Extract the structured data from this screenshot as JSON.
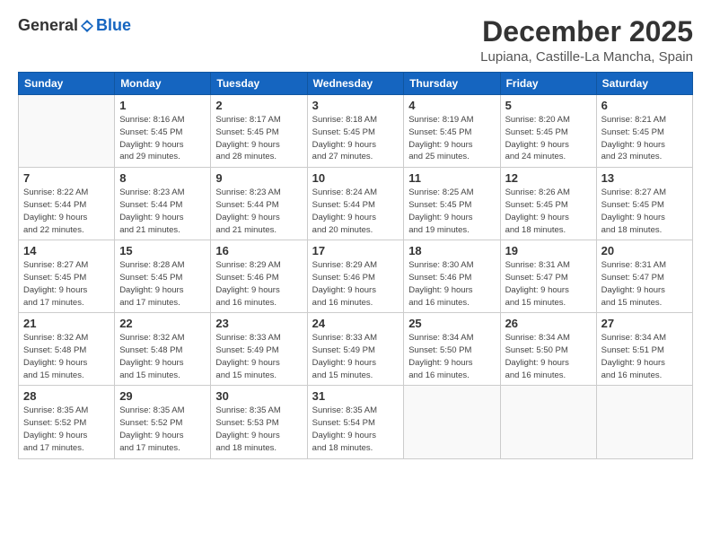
{
  "header": {
    "logo_general": "General",
    "logo_blue": "Blue",
    "month": "December 2025",
    "location": "Lupiana, Castille-La Mancha, Spain"
  },
  "days_of_week": [
    "Sunday",
    "Monday",
    "Tuesday",
    "Wednesday",
    "Thursday",
    "Friday",
    "Saturday"
  ],
  "weeks": [
    [
      {
        "day": "",
        "info": ""
      },
      {
        "day": "1",
        "info": "Sunrise: 8:16 AM\nSunset: 5:45 PM\nDaylight: 9 hours\nand 29 minutes."
      },
      {
        "day": "2",
        "info": "Sunrise: 8:17 AM\nSunset: 5:45 PM\nDaylight: 9 hours\nand 28 minutes."
      },
      {
        "day": "3",
        "info": "Sunrise: 8:18 AM\nSunset: 5:45 PM\nDaylight: 9 hours\nand 27 minutes."
      },
      {
        "day": "4",
        "info": "Sunrise: 8:19 AM\nSunset: 5:45 PM\nDaylight: 9 hours\nand 25 minutes."
      },
      {
        "day": "5",
        "info": "Sunrise: 8:20 AM\nSunset: 5:45 PM\nDaylight: 9 hours\nand 24 minutes."
      },
      {
        "day": "6",
        "info": "Sunrise: 8:21 AM\nSunset: 5:45 PM\nDaylight: 9 hours\nand 23 minutes."
      }
    ],
    [
      {
        "day": "7",
        "info": "Sunrise: 8:22 AM\nSunset: 5:44 PM\nDaylight: 9 hours\nand 22 minutes."
      },
      {
        "day": "8",
        "info": "Sunrise: 8:23 AM\nSunset: 5:44 PM\nDaylight: 9 hours\nand 21 minutes."
      },
      {
        "day": "9",
        "info": "Sunrise: 8:23 AM\nSunset: 5:44 PM\nDaylight: 9 hours\nand 21 minutes."
      },
      {
        "day": "10",
        "info": "Sunrise: 8:24 AM\nSunset: 5:44 PM\nDaylight: 9 hours\nand 20 minutes."
      },
      {
        "day": "11",
        "info": "Sunrise: 8:25 AM\nSunset: 5:45 PM\nDaylight: 9 hours\nand 19 minutes."
      },
      {
        "day": "12",
        "info": "Sunrise: 8:26 AM\nSunset: 5:45 PM\nDaylight: 9 hours\nand 18 minutes."
      },
      {
        "day": "13",
        "info": "Sunrise: 8:27 AM\nSunset: 5:45 PM\nDaylight: 9 hours\nand 18 minutes."
      }
    ],
    [
      {
        "day": "14",
        "info": "Sunrise: 8:27 AM\nSunset: 5:45 PM\nDaylight: 9 hours\nand 17 minutes."
      },
      {
        "day": "15",
        "info": "Sunrise: 8:28 AM\nSunset: 5:45 PM\nDaylight: 9 hours\nand 17 minutes."
      },
      {
        "day": "16",
        "info": "Sunrise: 8:29 AM\nSunset: 5:46 PM\nDaylight: 9 hours\nand 16 minutes."
      },
      {
        "day": "17",
        "info": "Sunrise: 8:29 AM\nSunset: 5:46 PM\nDaylight: 9 hours\nand 16 minutes."
      },
      {
        "day": "18",
        "info": "Sunrise: 8:30 AM\nSunset: 5:46 PM\nDaylight: 9 hours\nand 16 minutes."
      },
      {
        "day": "19",
        "info": "Sunrise: 8:31 AM\nSunset: 5:47 PM\nDaylight: 9 hours\nand 15 minutes."
      },
      {
        "day": "20",
        "info": "Sunrise: 8:31 AM\nSunset: 5:47 PM\nDaylight: 9 hours\nand 15 minutes."
      }
    ],
    [
      {
        "day": "21",
        "info": "Sunrise: 8:32 AM\nSunset: 5:48 PM\nDaylight: 9 hours\nand 15 minutes."
      },
      {
        "day": "22",
        "info": "Sunrise: 8:32 AM\nSunset: 5:48 PM\nDaylight: 9 hours\nand 15 minutes."
      },
      {
        "day": "23",
        "info": "Sunrise: 8:33 AM\nSunset: 5:49 PM\nDaylight: 9 hours\nand 15 minutes."
      },
      {
        "day": "24",
        "info": "Sunrise: 8:33 AM\nSunset: 5:49 PM\nDaylight: 9 hours\nand 15 minutes."
      },
      {
        "day": "25",
        "info": "Sunrise: 8:34 AM\nSunset: 5:50 PM\nDaylight: 9 hours\nand 16 minutes."
      },
      {
        "day": "26",
        "info": "Sunrise: 8:34 AM\nSunset: 5:50 PM\nDaylight: 9 hours\nand 16 minutes."
      },
      {
        "day": "27",
        "info": "Sunrise: 8:34 AM\nSunset: 5:51 PM\nDaylight: 9 hours\nand 16 minutes."
      }
    ],
    [
      {
        "day": "28",
        "info": "Sunrise: 8:35 AM\nSunset: 5:52 PM\nDaylight: 9 hours\nand 17 minutes."
      },
      {
        "day": "29",
        "info": "Sunrise: 8:35 AM\nSunset: 5:52 PM\nDaylight: 9 hours\nand 17 minutes."
      },
      {
        "day": "30",
        "info": "Sunrise: 8:35 AM\nSunset: 5:53 PM\nDaylight: 9 hours\nand 18 minutes."
      },
      {
        "day": "31",
        "info": "Sunrise: 8:35 AM\nSunset: 5:54 PM\nDaylight: 9 hours\nand 18 minutes."
      },
      {
        "day": "",
        "info": ""
      },
      {
        "day": "",
        "info": ""
      },
      {
        "day": "",
        "info": ""
      }
    ]
  ]
}
